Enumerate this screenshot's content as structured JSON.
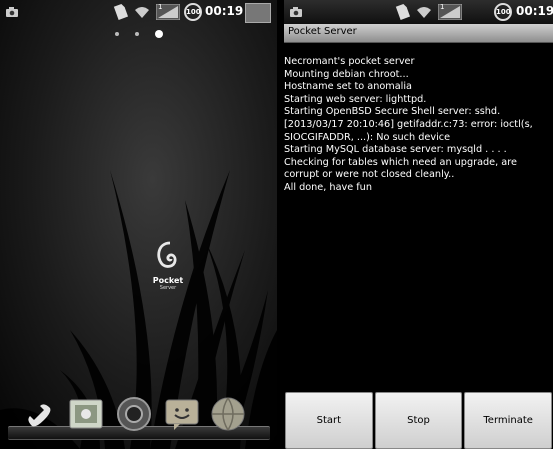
{
  "left_screen": {
    "status_bar": {
      "time": "00:19",
      "battery": "100",
      "signal_badge": "1"
    },
    "page_indicator": {
      "count": 3,
      "active_index": 2
    },
    "desktop_app": {
      "label": "Pocket",
      "sublabel": "Server"
    },
    "dock_icons": [
      "phone-icon",
      "gallery-icon",
      "camera-icon",
      "messaging-icon",
      "browser-icon"
    ]
  },
  "right_screen": {
    "status_bar": {
      "time": "00:19",
      "battery": "100",
      "signal_badge": "1"
    },
    "app_title": "Pocket Server",
    "log_lines": [
      "Necromant's pocket server",
      "Mounting debian chroot...",
      "Hostname set to anomalia",
      "Starting web server: lighttpd.",
      "Starting OpenBSD Secure Shell server: sshd.",
      "[2013/03/17 20:10:46] getifaddr.c:73: error: ioctl(s, SIOCGIFADDR, ...): No such device",
      "Starting MySQL database server: mysqld . . . . Checking for tables which need an upgrade, are corrupt or were not closed cleanly..",
      "All done, have fun"
    ],
    "buttons": {
      "start": "Start",
      "stop": "Stop",
      "terminate": "Terminate"
    }
  }
}
